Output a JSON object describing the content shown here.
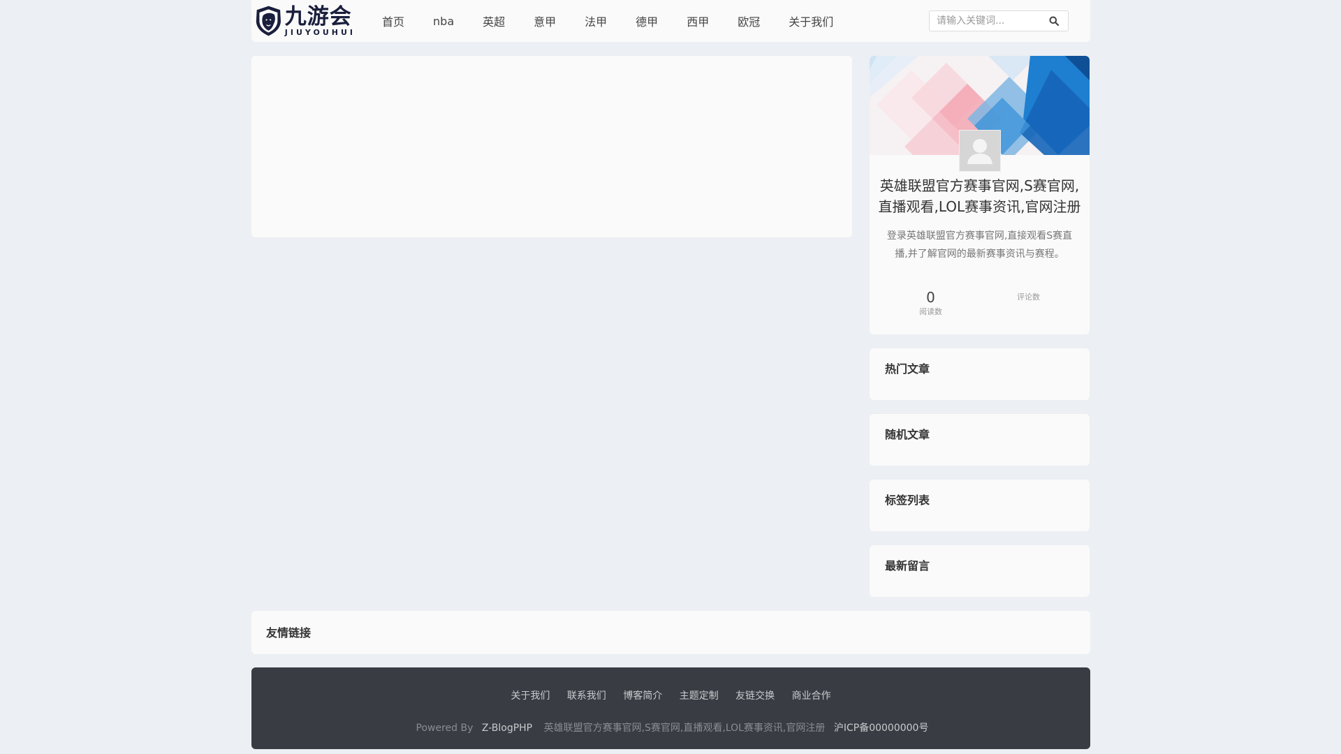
{
  "header": {
    "logo": {
      "cn": "九游会",
      "en": "JIUYOUHUI"
    },
    "nav": [
      "首页",
      "nba",
      "英超",
      "意甲",
      "法甲",
      "德甲",
      "西甲",
      "欧冠",
      "关于我们"
    ],
    "search": {
      "placeholder": "请输入关键词...",
      "icon": "search-icon"
    }
  },
  "sidebar": {
    "profile": {
      "title": "英雄联盟官方赛事官网,S赛官网,直播观看,LOL赛事资讯,官网注册",
      "description": "登录英雄联盟官方赛事官网,直接观看S赛直播,并了解官网的最新赛事资讯与赛程。",
      "reads": {
        "value": "0",
        "label": "阅读数"
      },
      "comments": {
        "label": "评论数"
      }
    },
    "widgets": [
      "热门文章",
      "随机文章",
      "标签列表",
      "最新留言"
    ]
  },
  "links": {
    "title": "友情链接"
  },
  "footer": {
    "nav": [
      "关于我们",
      "联系我们",
      "博客简介",
      "主题定制",
      "友链交换",
      "商业合作"
    ],
    "powered_prefix": "Powered By",
    "powered_name": "Z-BlogPHP",
    "site_name": "英雄联盟官方赛事官网,S赛官网,直播观看,LOL赛事资讯,官网注册",
    "icp": "沪ICP备00000000号"
  },
  "colors": {
    "page_bg": "#eceff3",
    "card_bg": "#fafafa",
    "footer_bg": "#393c42",
    "logo_navy": "#1a1f3d",
    "banner_blue": "#1e7fd0",
    "banner_pink": "#f3a7b4"
  }
}
